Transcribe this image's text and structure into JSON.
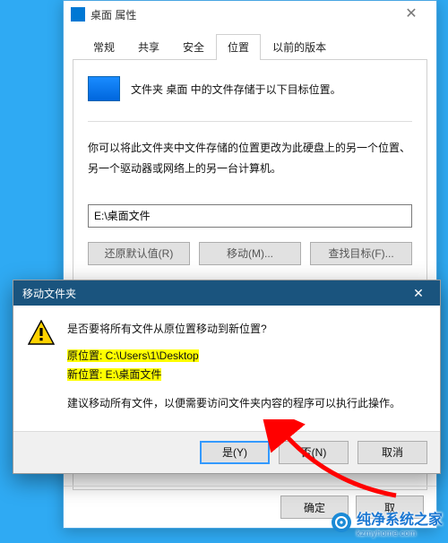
{
  "propWindow": {
    "title": "桌面 属性",
    "tabs": [
      "常规",
      "共享",
      "安全",
      "位置",
      "以前的版本"
    ],
    "activeTabIndex": 3,
    "folderLine": "文件夹 桌面 中的文件存储于以下目标位置。",
    "description": "你可以将此文件夹中文件存储的位置更改为此硬盘上的另一个位置、另一个驱动器或网络上的另一台计算机。",
    "pathValue": "E:\\桌面文件",
    "buttons": {
      "restore": "还原默认值(R)",
      "move": "移动(M)...",
      "find": "查找目标(F)..."
    },
    "bottomButtons": {
      "ok": "确定",
      "cancel": "取"
    }
  },
  "confirmDialog": {
    "title": "移动文件夹",
    "question": "是否要将所有文件从原位置移动到新位置?",
    "oldLabel": "原位置: ",
    "oldPath": "C:\\Users\\1\\Desktop",
    "newLabel": "新位置: ",
    "newPath": "E:\\桌面文件",
    "advice": "建议移动所有文件，以便需要访问文件夹内容的程序可以执行此操作。",
    "buttons": {
      "yes": "是(Y)",
      "no": "否(N)",
      "cancel": "取消"
    }
  },
  "watermark": {
    "brand": "纯净系统之家",
    "url": "kzmyhome.com"
  }
}
